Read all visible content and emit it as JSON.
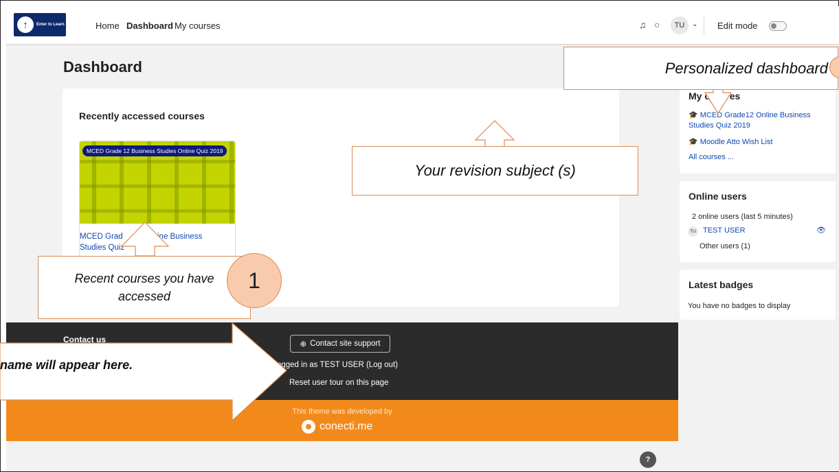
{
  "nav": {
    "logo_text": "Enter to Learn",
    "links": [
      "Home",
      "Dashboard",
      "My courses"
    ],
    "avatar": "TU",
    "edit_mode": "Edit mode"
  },
  "page": {
    "title": "Dashboard"
  },
  "recent": {
    "heading": "Recently accessed courses",
    "course_badge": "MCED Grade 12 Business Studies Online Quiz 2019",
    "course_name_a": "MCED Grad",
    "course_name_b": "ine Business",
    "course_name_c": "Studies Quiz"
  },
  "sidebar": {
    "my_courses_title": "My co",
    "my_courses_title_end": "es",
    "course1": "MCED Grade12 Online Business Studies Quiz 2019",
    "course2": "Moodle Atto Wish List",
    "all_courses": "All courses ...",
    "online_title": "Online users",
    "online_count": "2 online users (last 5 minutes)",
    "user_avatar": "TU",
    "user_name": "TEST USER",
    "other_users": "Other users (1)",
    "badges_title": "Latest badges",
    "badges_empty": "You have no badges to display"
  },
  "footer": {
    "contact": "Contact us",
    "support": "Contact site support",
    "logged_in": "u are logged in as TEST USER (Log out)",
    "reset_tour": "Reset user tour on this page",
    "theme_by": "This theme was developed by",
    "brand": "conecti.me"
  },
  "help": "?",
  "annotations": {
    "personalized": "Personalized dashboard",
    "revision": "Your revision subject (s)",
    "recent": "Recent courses you have accessed",
    "step": "1",
    "name_here": "name will appear here."
  },
  "colors": {
    "accent": "#f28a1b",
    "link": "#0f47ad",
    "footer": "#2b2b2b",
    "callout_border": "#d98b52"
  }
}
